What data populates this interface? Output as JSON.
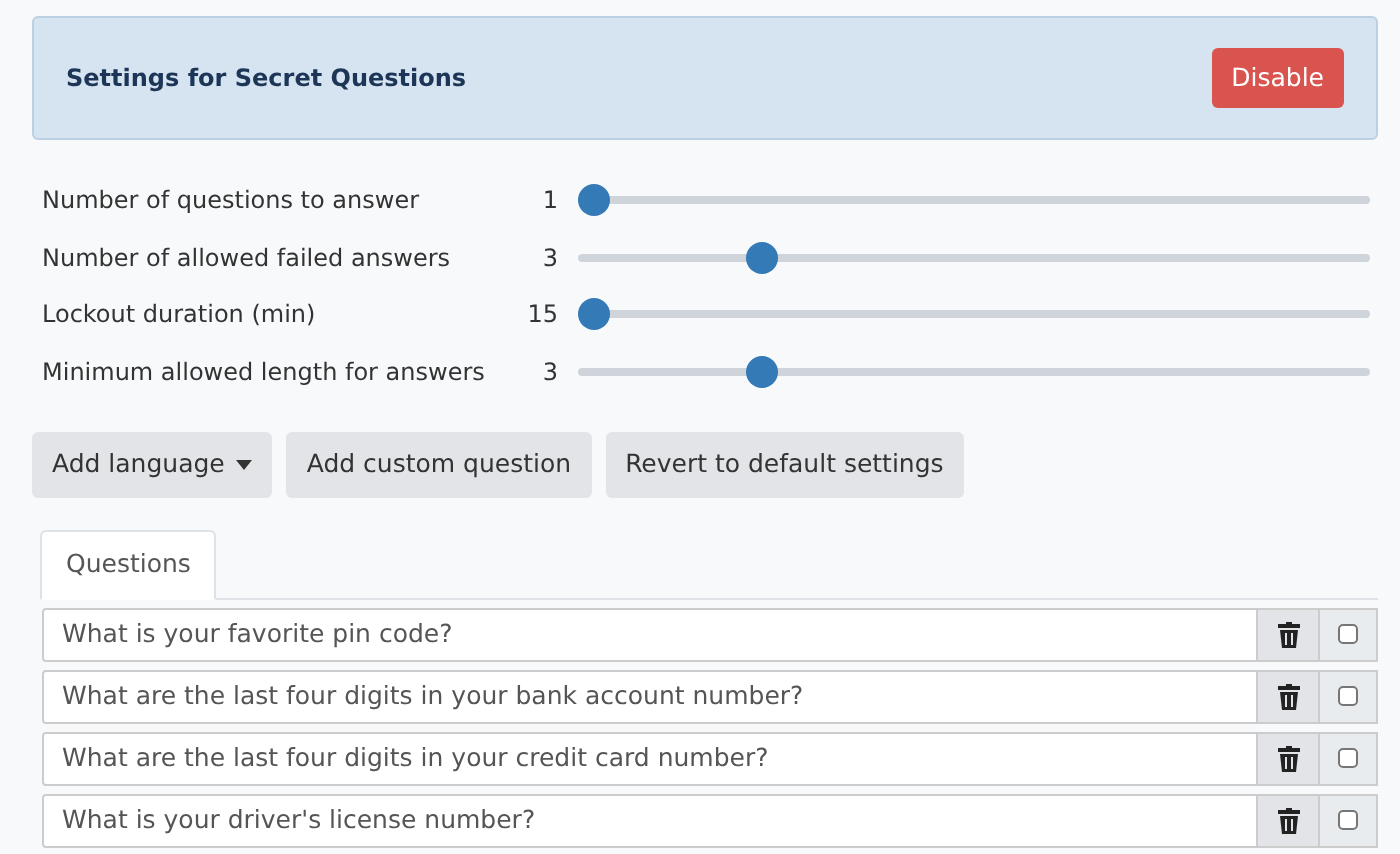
{
  "header": {
    "title": "Settings for Secret Questions",
    "button": "Disable"
  },
  "settings": [
    {
      "label": "Number of questions to answer",
      "value": "1",
      "level": 0
    },
    {
      "label": "Number of allowed failed answers",
      "value": "3",
      "level": 0.22
    },
    {
      "label": "Lockout duration (min)",
      "value": "15",
      "level": 0
    },
    {
      "label": "Minimum allowed length for answers",
      "value": "3",
      "level": 0.22
    }
  ],
  "actions": [
    {
      "label": "Add language",
      "kind": "dropdown"
    },
    {
      "label": "Add custom question",
      "kind": "plain"
    },
    {
      "label": "Revert to default settings",
      "kind": "plain"
    }
  ],
  "tabs": [
    {
      "label": "Questions",
      "selected": true
    }
  ],
  "questions": [
    {
      "value": "What is your favorite pin code?",
      "checked": false
    },
    {
      "value": "What are the last four digits in your bank account number?",
      "checked": false
    },
    {
      "value": "What are the last four digits in your credit card number?",
      "checked": false
    },
    {
      "value": "What is your driver's license number?",
      "checked": false
    }
  ]
}
